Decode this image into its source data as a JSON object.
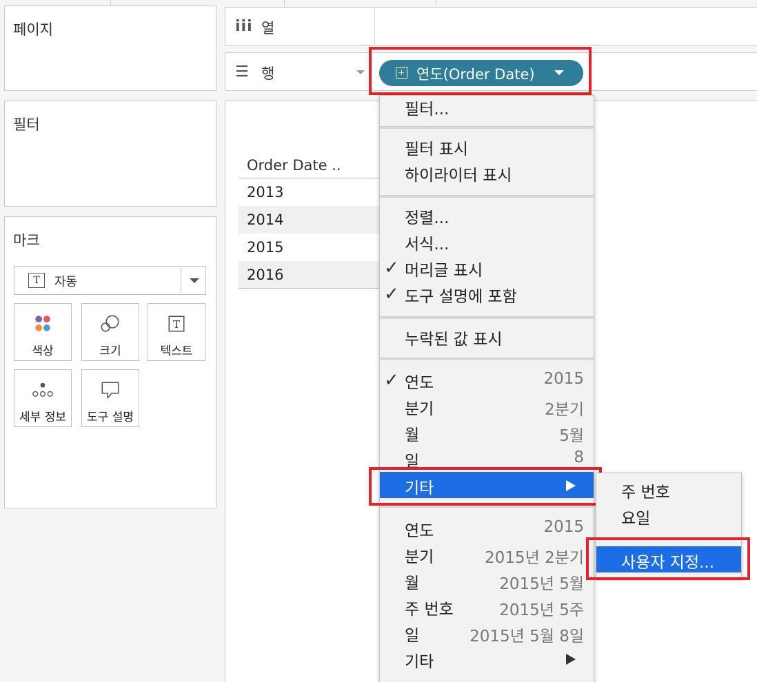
{
  "left_panels": {
    "pages_title": "페이지",
    "filters_title": "필터",
    "marks_title": "마크",
    "mark_type": "자동",
    "mark_type_icon": "T",
    "mark_buttons": [
      {
        "label": "색상",
        "icon": "color-dots-icon"
      },
      {
        "label": "크기",
        "icon": "size-circles-icon"
      },
      {
        "label": "텍스트",
        "icon": "text-T-icon"
      },
      {
        "label": "세부 정보",
        "icon": "detail-dots-icon"
      },
      {
        "label": "도구 설명",
        "icon": "tooltip-bubble-icon"
      }
    ],
    "text_icon_glyph": "T"
  },
  "shelves": {
    "columns_label": "열",
    "rows_label": "행",
    "columns_icon": "iii",
    "rows_icon": "☰"
  },
  "pill": {
    "label": "연도(Order Date)",
    "color": "#2f7e99"
  },
  "view": {
    "column_header": "Order Date ..",
    "years": [
      "2013",
      "2014",
      "2015",
      "2016"
    ]
  },
  "context_menu": {
    "filter": "필터...",
    "show_filter": "필터 표시",
    "show_highlighter": "하이라이터 표시",
    "sort": "정렬...",
    "format": "서식...",
    "show_header": "머리글 표시",
    "include_in_tooltip": "도구 설명에 포함",
    "show_missing_values": "누락된 값 표시",
    "discrete_parts": [
      {
        "label": "연도",
        "value": "2015",
        "checked": true
      },
      {
        "label": "분기",
        "value": "2분기",
        "checked": false
      },
      {
        "label": "월",
        "value": "5월",
        "checked": false
      },
      {
        "label": "일",
        "value": "8",
        "checked": false
      }
    ],
    "more_label": "기타",
    "continuous_parts": [
      {
        "label": "연도",
        "value": "2015"
      },
      {
        "label": "분기",
        "value": "2015년 2분기"
      },
      {
        "label": "월",
        "value": "2015년 5월"
      },
      {
        "label": "주 번호",
        "value": "2015년 5주"
      },
      {
        "label": "일",
        "value": "2015년 5월 8일"
      }
    ],
    "more_label_2": "기타",
    "checkmark": "✓",
    "highlight_color": "#1d6ee5"
  },
  "submenu": {
    "week_number": "주 번호",
    "weekday": "요일",
    "custom": "사용자 지정..."
  }
}
